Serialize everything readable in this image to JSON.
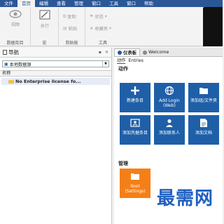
{
  "menu": [
    "文件",
    "首页",
    "编辑",
    "查看",
    "管理",
    "窗口",
    "工具",
    "窗口",
    "帮助"
  ],
  "menu_active_index": 1,
  "ribbon": {
    "view_label": "视图",
    "group_database": "数据库目",
    "execute_label": "执行",
    "group_macro": "宏",
    "copy_label": "复制",
    "paste_label": "粘贴",
    "group_clipboard": "剪贴板",
    "status_label": "状态",
    "favorites_label": "收藏夹",
    "group_tools": "工具"
  },
  "nav": {
    "title": "导航",
    "db_select": "本地数据源",
    "column": "名称",
    "item": "No Enterprise license fo..."
  },
  "dashboard": {
    "tab1": "仪表板",
    "tab2": "Welcome",
    "subtab1": "动作",
    "subtab2": "Entries",
    "section_actions": "动作",
    "section_manage": "管理",
    "tiles": [
      {
        "label": "新建条目"
      },
      {
        "label": "Add Login (Web)"
      },
      {
        "label": "添加组/文件夹"
      },
      {
        "label": "添加凭据条目"
      },
      {
        "label": "添加联系人"
      },
      {
        "label": "添加文档"
      }
    ],
    "manage_tile": "Root (Settings)"
  },
  "watermark": "最需网",
  "colors": {
    "menu": "#2b5797",
    "tile_blue": "#1f5fa8",
    "tile_orange": "#f57f17"
  }
}
